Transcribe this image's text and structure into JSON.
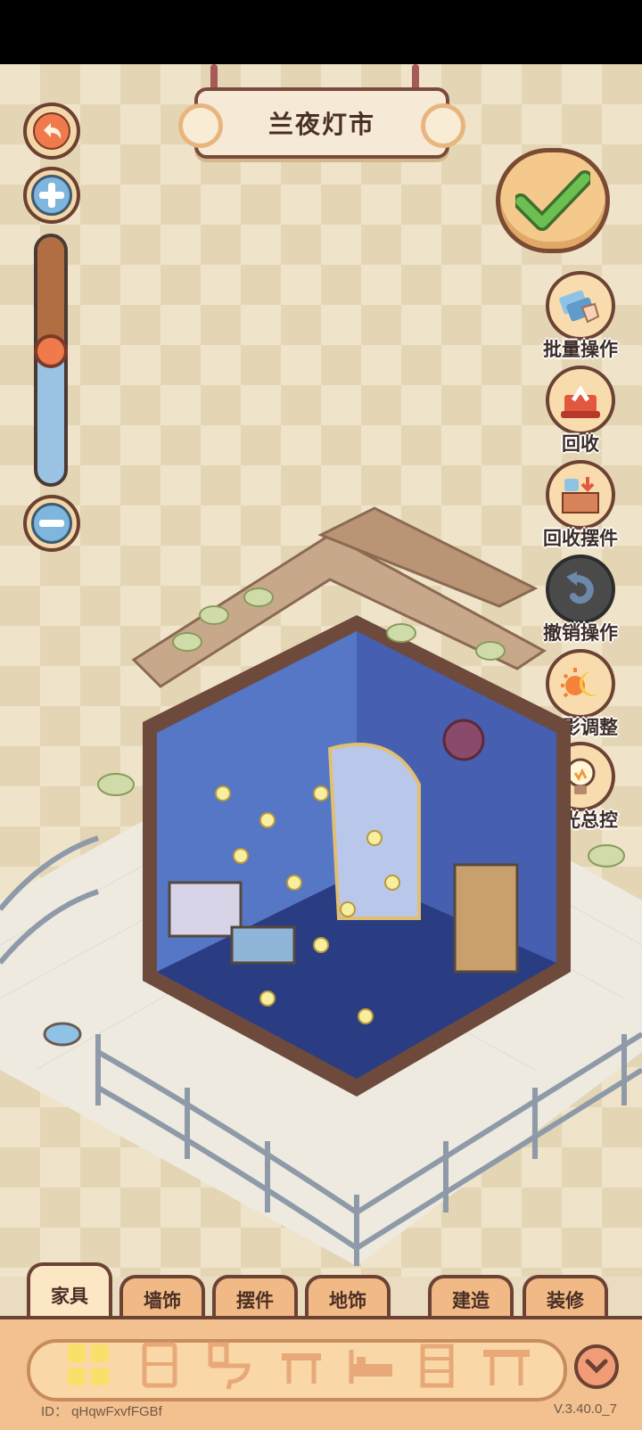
{
  "title": "兰夜灯市",
  "side_tools": [
    {
      "label": "批量操作",
      "icon": "batch-hand-icon"
    },
    {
      "label": "回收",
      "icon": "recycle-box-icon"
    },
    {
      "label": "回收摆件",
      "icon": "recycle-items-icon"
    },
    {
      "label": "撤销操作",
      "icon": "undo-icon"
    },
    {
      "label": "光影调整",
      "icon": "sun-moon-icon"
    },
    {
      "label": "灯光总控",
      "icon": "lightbulb-icon"
    }
  ],
  "zoom": {
    "level": 0.57
  },
  "tabs": [
    "家具",
    "墙饰",
    "摆件",
    "地饰",
    "建造",
    "装修"
  ],
  "active_tab": "家具",
  "categories": [
    "all-grid-icon",
    "cabinet-icon",
    "toilet-icon",
    "table-icon",
    "bed-icon",
    "shelf-icon",
    "desk-icon"
  ],
  "footer": {
    "id": "ID： qHqwFxvfFGBf",
    "version": "V.3.40.0_7"
  },
  "colors": {
    "accent": "#f0b985",
    "outline": "#6c4234",
    "confirm": "#5fb24b"
  }
}
